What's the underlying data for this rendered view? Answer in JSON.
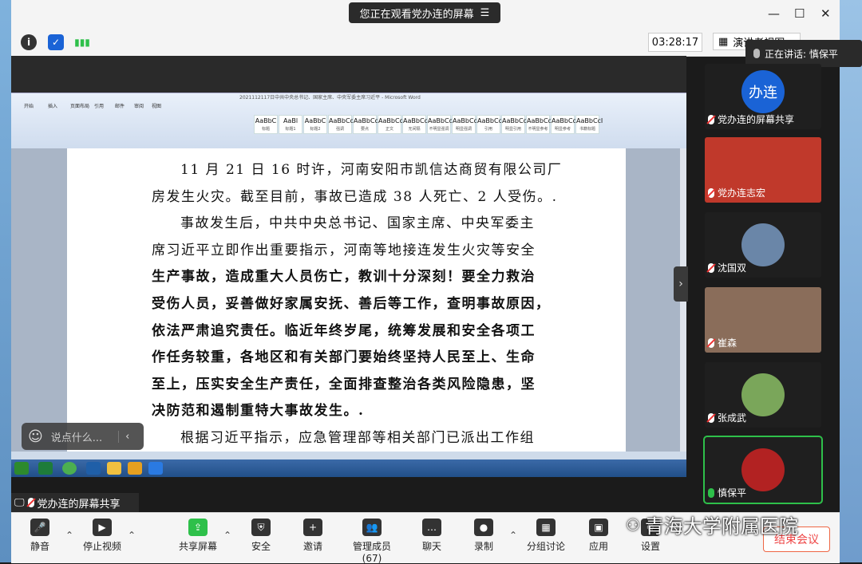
{
  "banner": {
    "text": "您正在观看党办连的屏幕"
  },
  "window": {
    "minimize": "—",
    "maximize": "☐",
    "close": "✕"
  },
  "timer": "03:28:17",
  "view_label": "演讲者视图",
  "speaking": "正在讲话: 慎保平",
  "word": {
    "title": "2021112117日中共中央总书记、国家主席、中央军委主席习近平 - Microsoft Word",
    "tabs": [
      "开始",
      "插入",
      "页面布局",
      "引用",
      "邮件",
      "审阅",
      "视图"
    ],
    "styles": [
      {
        "sample": "AaBbC",
        "name": "标题"
      },
      {
        "sample": "AaBl",
        "name": "标题1"
      },
      {
        "sample": "AaBbC",
        "name": "标题2"
      },
      {
        "sample": "AaBbCcD",
        "name": "强调"
      },
      {
        "sample": "AaBbCcD",
        "name": "要点"
      },
      {
        "sample": "AaBbCcD",
        "name": "正文"
      },
      {
        "sample": "AaBbCcD",
        "name": "无间隔"
      },
      {
        "sample": "AaBbCcD",
        "name": "不明显强调"
      },
      {
        "sample": "AaBbCcD",
        "name": "明显强调"
      },
      {
        "sample": "AaBbCcD",
        "name": "引用"
      },
      {
        "sample": "AaBbCcD",
        "name": "明显引用"
      },
      {
        "sample": "AaBbCcD",
        "name": "不明显参考"
      },
      {
        "sample": "AaBbCcD",
        "name": "明显参考"
      },
      {
        "sample": "AaBbCcI",
        "name": "书籍标题"
      }
    ],
    "lines": [
      {
        "text": "11 月 21 日 16 时许，河南安阳市凯信达商贸有限公司厂",
        "bold": false,
        "indent": true
      },
      {
        "text": "房发生火灾。截至目前，事故已造成 38 人死亡、2 人受伤。.",
        "bold": false,
        "indent": false
      },
      {
        "text": "事故发生后，中共中央总书记、国家主席、中央军委主",
        "bold": false,
        "indent": true
      },
      {
        "text": "席习近平立即作出重要指示，河南等地接连发生火灾等安全",
        "bold": false,
        "indent": false
      },
      {
        "text": "生产事故，造成重大人员伤亡，教训十分深刻！要全力救治",
        "bold": true,
        "indent": false
      },
      {
        "text": "受伤人员，妥善做好家属安抚、善后等工作，查明事故原因，",
        "bold": true,
        "indent": false
      },
      {
        "text": "依法严肃追究责任。临近年终岁尾，统筹发展和安全各项工",
        "bold": true,
        "indent": false
      },
      {
        "text": "作任务较重，各地区和有关部门要始终坚持人民至上、生命",
        "bold": true,
        "indent": false
      },
      {
        "text": "至上，压实安全生产责任，全面排查整治各类风险隐患，坚",
        "bold": true,
        "indent": false
      },
      {
        "text": "决防范和遏制重特大事故发生。.",
        "bold": true,
        "indent": false
      },
      {
        "text": "根据习近平指示，应急管理部等相关部门已派出工作组",
        "bold": false,
        "indent": true
      }
    ]
  },
  "comment": {
    "placeholder": "说点什么..."
  },
  "share_label": "党办连的屏幕共享",
  "participants": [
    {
      "name": "党办连的屏幕共享",
      "avatar_text": "办连",
      "mic": "muted",
      "color": "#1a63d6"
    },
    {
      "name": "党办连志宏",
      "avatar_text": "",
      "mic": "muted",
      "color": "#c0392b"
    },
    {
      "name": "沈国双",
      "avatar_text": "",
      "mic": "muted",
      "color": "#6a86a8"
    },
    {
      "name": "崔森",
      "avatar_text": "",
      "mic": "muted",
      "color": "#8a6d5a"
    },
    {
      "name": "张成武",
      "avatar_text": "",
      "mic": "muted",
      "color": "#7aa65a"
    },
    {
      "name": "慎保平",
      "avatar_text": "",
      "mic": "active",
      "color": "#b22222"
    }
  ],
  "toolbar": [
    {
      "label": "静音",
      "icon": "🎤",
      "caret": true
    },
    {
      "label": "停止视频",
      "icon": "▶",
      "caret": true
    },
    {
      "label": "共享屏幕",
      "icon": "⇪",
      "caret": true
    },
    {
      "label": "安全",
      "icon": "⛨",
      "caret": false
    },
    {
      "label": "邀请",
      "icon": "+",
      "caret": false
    },
    {
      "label": "管理成员(67)",
      "icon": "👥",
      "caret": false
    },
    {
      "label": "聊天",
      "icon": "…",
      "caret": false
    },
    {
      "label": "录制",
      "icon": "●",
      "caret": true
    },
    {
      "label": "分组讨论",
      "icon": "▦",
      "caret": false
    },
    {
      "label": "应用",
      "icon": "▣",
      "caret": false
    },
    {
      "label": "设置",
      "icon": "⚙",
      "caret": false
    }
  ],
  "end_button": "结束会议",
  "watermark": "青海大学附属医院",
  "colors": {
    "accent": "#1a63d6",
    "danger": "#e44444",
    "green": "#2ec04a"
  }
}
